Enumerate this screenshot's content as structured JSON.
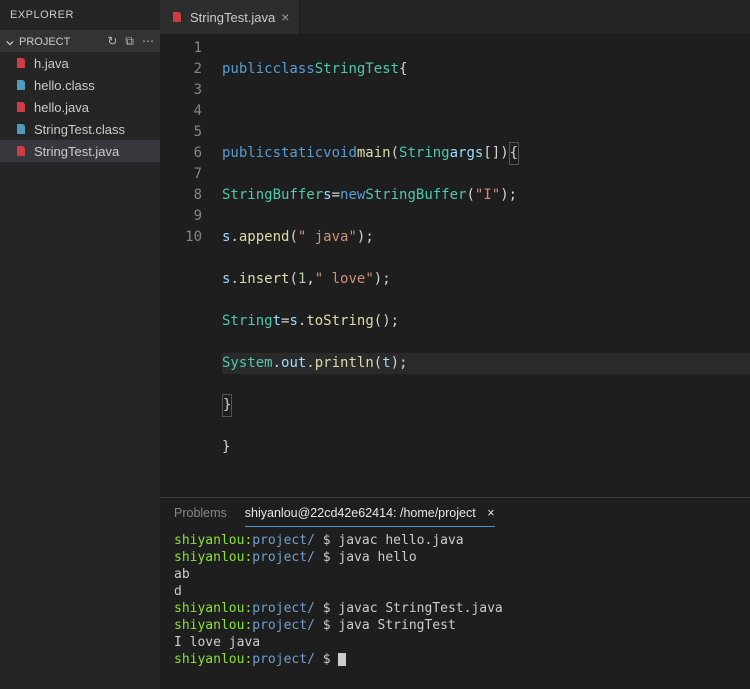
{
  "explorer": {
    "title": "Explorer",
    "section": "PROJECT",
    "files": [
      {
        "name": "h.java",
        "kind": "java"
      },
      {
        "name": "hello.class",
        "kind": "class"
      },
      {
        "name": "hello.java",
        "kind": "java"
      },
      {
        "name": "StringTest.class",
        "kind": "class"
      },
      {
        "name": "StringTest.java",
        "kind": "java"
      }
    ],
    "action_icons": {
      "refresh": "↻",
      "new": "⧉",
      "more": "⋯"
    }
  },
  "open_tab": {
    "label": "StringTest.java"
  },
  "editor": {
    "lines": [
      "1",
      "2",
      "3",
      "4",
      "5",
      "6",
      "7",
      "8",
      "9",
      "10"
    ]
  },
  "code": {
    "l1": {
      "kw1": "public",
      "kw2": "class",
      "cls": "StringTest",
      "brace": "{"
    },
    "l3": {
      "kw1": "public",
      "kw2": "static",
      "kw3": "void",
      "fn": "main",
      "open": "(",
      "type": "String",
      "var": "args",
      "arr": "[]",
      "close": ")"
    },
    "l4": {
      "type1": "StringBuffer",
      "var": "s",
      "eq": "=",
      "kw": "new",
      "type2": "StringBuffer",
      "open": "(",
      "str": "\"I\"",
      "close": ");"
    },
    "l5": {
      "var": "s",
      "dot": ".",
      "fn": "append",
      "open": "(",
      "str": "\" java\"",
      "close": ");"
    },
    "l6": {
      "var": "s",
      "dot": ".",
      "fn": "insert",
      "open": "(",
      "num": "1",
      "comma": ",",
      "str": "\" love\"",
      "close": ");"
    },
    "l7": {
      "type": "String",
      "var": "t",
      "eq": "=",
      "var2": "s",
      "dot": ".",
      "fn": "toString",
      "paren": "();"
    },
    "l8": {
      "cls": "System",
      "dot1": ".",
      "out": "out",
      "dot2": ".",
      "fn": "println",
      "open": "(",
      "var": "t",
      "close": ");"
    }
  },
  "terminal": {
    "tabs": {
      "problems": "Problems",
      "title": "shiyanlou@22cd42e62414: /home/project"
    },
    "prompt": {
      "user": "shiyanlou:",
      "path": "project/",
      "sep": " $ "
    },
    "lines": [
      {
        "cmd": "javac hello.java",
        "out": []
      },
      {
        "cmd": "java hello",
        "out": [
          "ab",
          "d"
        ]
      },
      {
        "cmd": "javac StringTest.java",
        "out": []
      },
      {
        "cmd": "java StringTest",
        "out": [
          "I love java"
        ]
      },
      {
        "cmd": "",
        "out": []
      }
    ]
  }
}
